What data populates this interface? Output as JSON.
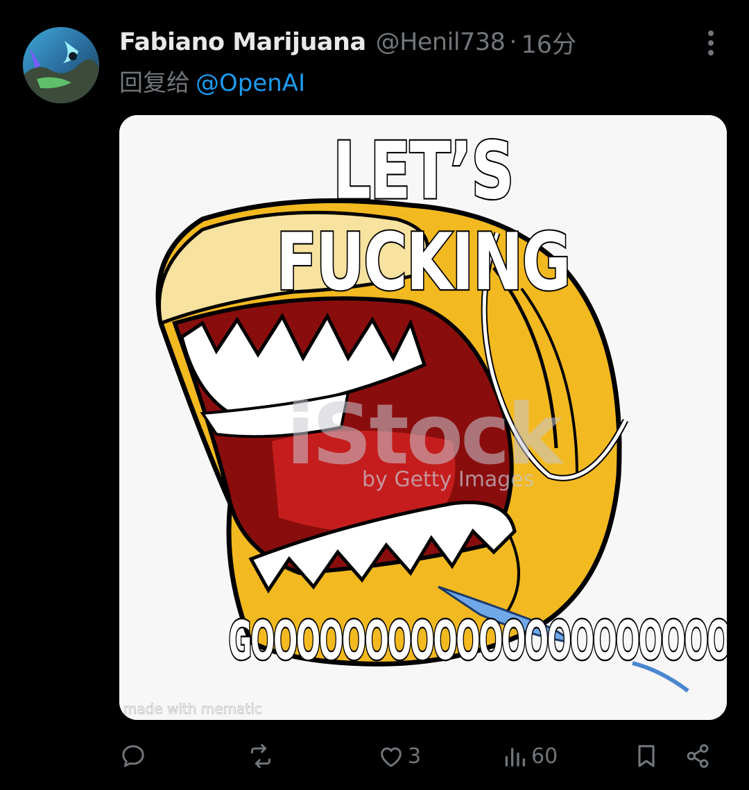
{
  "tweet": {
    "display_name": "Fabiano Marijuana",
    "handle": "@Henil738",
    "separator": "·",
    "time": "16分",
    "reply_prefix": "回复给",
    "reply_mention": "@OpenAI"
  },
  "media": {
    "meme_top_text": "LET’S FUCKING",
    "meme_bottom_text": "GOOOOOOOOOOOOOOOOOOOOOOOOO",
    "watermark": "iStock",
    "watermark_sub": "by Getty Images",
    "credit": "made with mematic"
  },
  "actions": {
    "reply_count": "",
    "retweet_count": "",
    "like_count": "3",
    "views_count": "60"
  },
  "icons": [
    "avatar",
    "more-icon",
    "reply-icon",
    "retweet-icon",
    "like-icon",
    "views-icon",
    "bookmark-icon",
    "share-icon"
  ],
  "colors": {
    "background": "#000000",
    "text_primary": "#e7e9ea",
    "text_secondary": "#71767b",
    "link": "#1d9bf0"
  }
}
